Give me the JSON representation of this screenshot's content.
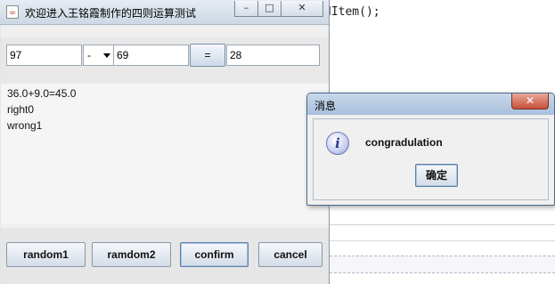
{
  "background_editor": {
    "code_fragment": "dItem();"
  },
  "main_window": {
    "title": "欢迎进入王铭霞制作的四则运算测试",
    "controls": {
      "minimize": "–",
      "maximize": "□",
      "close": "✕"
    },
    "inputs": {
      "operand1": "97",
      "operator": "-",
      "operand2": "69",
      "equals_label": "=",
      "answer": "28"
    },
    "output_lines": [
      "36.0+9.0=45.0",
      "right0",
      "wrong1"
    ],
    "buttons": {
      "random1": "random1",
      "random2": "ramdom2",
      "confirm": "confirm",
      "cancel": "cancel"
    }
  },
  "dialog": {
    "title": "消息",
    "close_label": "✕",
    "icon": "info-icon",
    "icon_glyph": "i",
    "message": "congradulation",
    "ok_label": "确定"
  }
}
